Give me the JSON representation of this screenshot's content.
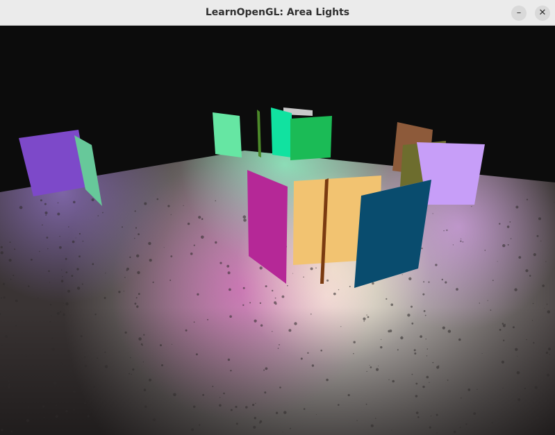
{
  "window": {
    "title": "LearnOpenGL: Area Lights",
    "minimize_icon": "minimize-icon",
    "close_icon": "close-icon"
  },
  "scene": {
    "background_color": "#0c0c0c",
    "floor_color": "#7c7a78",
    "lights": [
      {
        "name": "purple-panel",
        "color": "#7d49c9"
      },
      {
        "name": "mint-panel-left",
        "color": "#67c89a"
      },
      {
        "name": "mint-panel-back",
        "color": "#66e6a3"
      },
      {
        "name": "green-panel-back",
        "color": "#1bbb56"
      },
      {
        "name": "teal-panel-back",
        "color": "#11e2a0"
      },
      {
        "name": "brown-panel",
        "color": "#8d5a3a"
      },
      {
        "name": "olive-panel",
        "color": "#6d6d2e"
      },
      {
        "name": "lavender-panel",
        "color": "#c79ef8"
      },
      {
        "name": "magenta-panel",
        "color": "#b52897"
      },
      {
        "name": "yellow-panel",
        "color": "#f2c371"
      },
      {
        "name": "navy-panel",
        "color": "#094c6e"
      }
    ]
  }
}
